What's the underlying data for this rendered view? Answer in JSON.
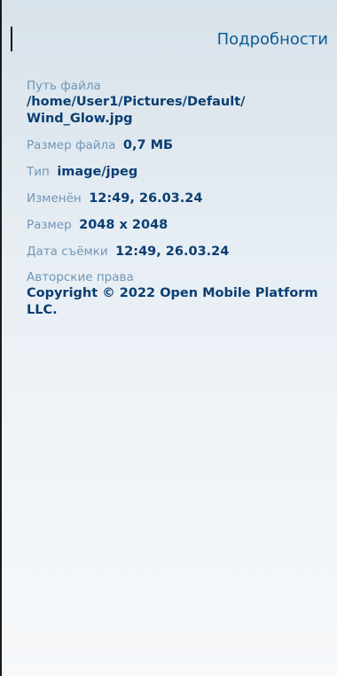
{
  "header": {
    "title": "Подробности"
  },
  "details": {
    "path": {
      "label": "Путь файла",
      "value": "/home/User1/Pictures/Default/\nWind_Glow.jpg"
    },
    "file_size": {
      "label": "Размер файла",
      "value": "0,7 МБ"
    },
    "type": {
      "label": "Тип",
      "value": "image/jpeg"
    },
    "modified": {
      "label": "Изменён",
      "value": "12:49, 26.03.24"
    },
    "dimensions": {
      "label": "Размер",
      "value": "2048 x 2048"
    },
    "date_taken": {
      "label": "Дата съёмки",
      "value": "12:49, 26.03.24"
    },
    "copyright": {
      "label": "Авторские права",
      "value": "Copyright © 2022  Open Mobile Platform LLC."
    }
  },
  "colors": {
    "accent": "#0c5c98",
    "label": "#6f96b8",
    "value": "#0a3e72"
  }
}
